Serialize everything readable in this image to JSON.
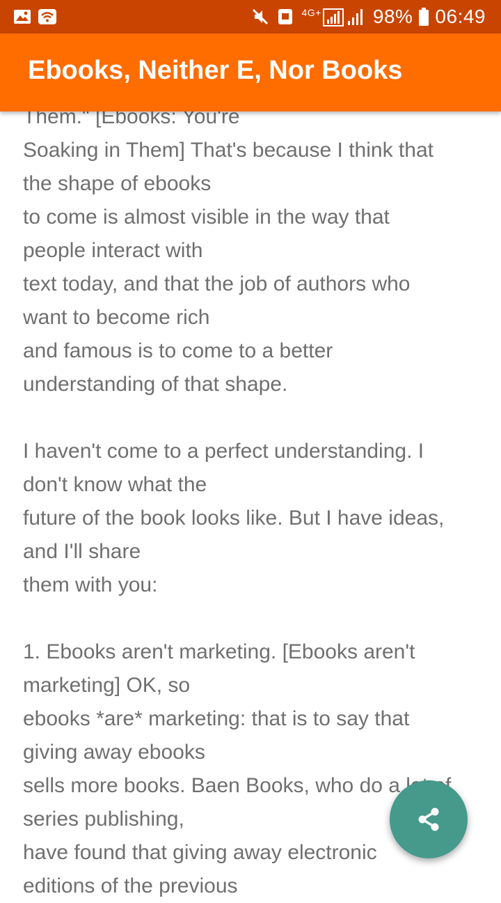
{
  "status_bar": {
    "network_label": "4G+",
    "battery": "98%",
    "time": "06:49",
    "icons": [
      "image-icon",
      "wifi-icon",
      "mute-icon",
      "sim-icon",
      "signal-icon",
      "battery-icon"
    ]
  },
  "app_bar": {
    "title": "Ebooks, Neither E, Nor Books",
    "color": "#ff6c00"
  },
  "article": {
    "lines": [
      "Them.\" [Ebooks: You're",
      "Soaking in Them] That's because I think that",
      "the shape of ebooks",
      "to come is almost visible in the way that",
      "people interact with",
      "text today, and that the job of authors who",
      "want to become rich",
      "and famous is to come to a better",
      "understanding of that shape.",
      "",
      "I haven't come to a perfect understanding. I",
      "don't know what the",
      "future of the book looks like. But I have ideas,",
      "and I'll share",
      "them with you:",
      "",
      "1. Ebooks aren't marketing. [Ebooks aren't",
      "marketing] OK, so",
      "ebooks *are* marketing: that is to say that",
      "giving away ebooks",
      "sells more books. Baen Books, who do a lot of",
      "series publishing,",
      "have found that giving away electronic",
      "editions of the previous"
    ]
  },
  "fab": {
    "icon": "share-icon",
    "color": "#459a8c"
  }
}
